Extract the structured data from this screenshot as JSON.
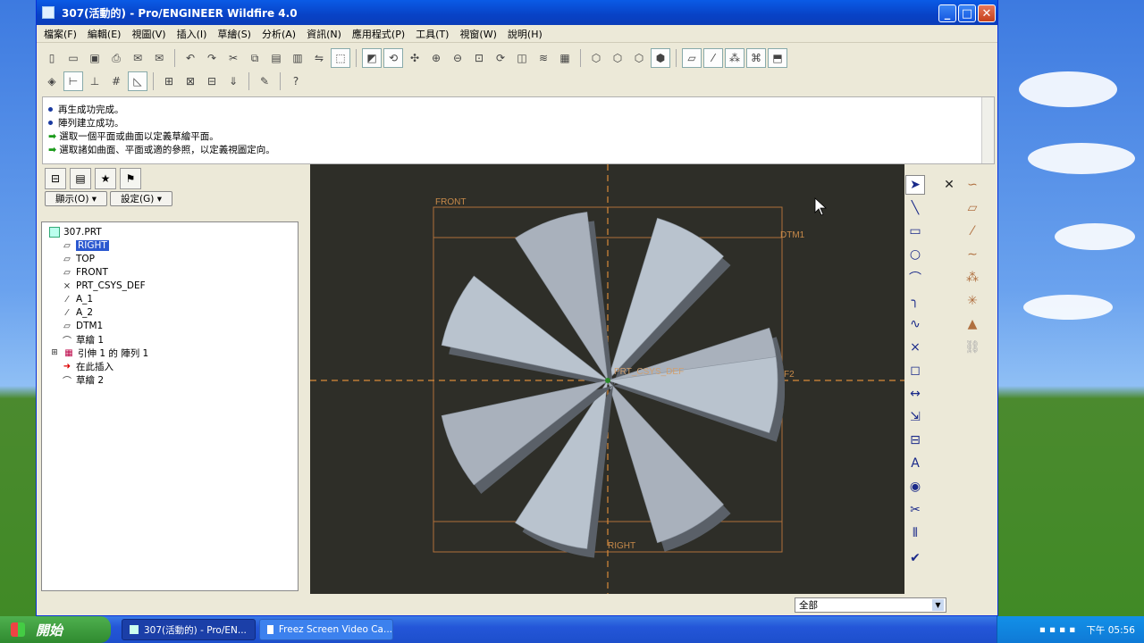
{
  "window": {
    "title": "307(活動的) - Pro/ENGINEER Wildfire 4.0",
    "min_icon": "minimize-icon",
    "max_icon": "maximize-icon",
    "close_icon": "close-icon"
  },
  "menu": [
    "檔案(F)",
    "編輯(E)",
    "視圖(V)",
    "插入(I)",
    "草繪(S)",
    "分析(A)",
    "資訊(N)",
    "應用程式(P)",
    "工具(T)",
    "視窗(W)",
    "說明(H)"
  ],
  "messages": [
    {
      "kind": "info",
      "text": "再生成功完成。"
    },
    {
      "kind": "info",
      "text": "陣列建立成功。"
    },
    {
      "kind": "prompt",
      "text": "選取一個平面或曲面以定義草繪平面。"
    },
    {
      "kind": "prompt",
      "text": "選取諸如曲面、平面或適的參照，以定義視圖定向。"
    }
  ],
  "panel": {
    "show_button": "顯示(O) ▾",
    "settings_button": "設定(G) ▾"
  },
  "tree": [
    {
      "label": "307.PRT",
      "icon": "part-icon",
      "selected": false
    },
    {
      "label": "RIGHT",
      "icon": "datum-plane-icon",
      "selected": true
    },
    {
      "label": "TOP",
      "icon": "datum-plane-icon",
      "selected": false
    },
    {
      "label": "FRONT",
      "icon": "datum-plane-icon",
      "selected": false
    },
    {
      "label": "PRT_CSYS_DEF",
      "icon": "csys-icon",
      "selected": false
    },
    {
      "label": "A_1",
      "icon": "axis-icon",
      "selected": false
    },
    {
      "label": "A_2",
      "icon": "axis-icon",
      "selected": false
    },
    {
      "label": "DTM1",
      "icon": "datum-plane-icon",
      "selected": false
    },
    {
      "label": "草繪 1",
      "icon": "sketch-icon",
      "selected": false
    },
    {
      "label": "引伸 1 的 陣列 1",
      "icon": "pattern-icon",
      "selected": false
    },
    {
      "label": "在此插入",
      "icon": "insert-here-icon",
      "selected": false
    },
    {
      "label": "草繪 2",
      "icon": "sketch-icon",
      "selected": false
    }
  ],
  "graphics": {
    "labels": {
      "front": "FRONT",
      "dtm1": "DTM1",
      "csys": "PRT_CSYS_DEF",
      "right": "RIGHT",
      "f2": "F2"
    }
  },
  "statusbar": {
    "filter": "全部"
  },
  "taskbar": {
    "start": "開始",
    "tasks": [
      "307(活動的) - Pro/EN...",
      "Freez Screen Video Ca..."
    ],
    "clock": "下午 05:56"
  }
}
